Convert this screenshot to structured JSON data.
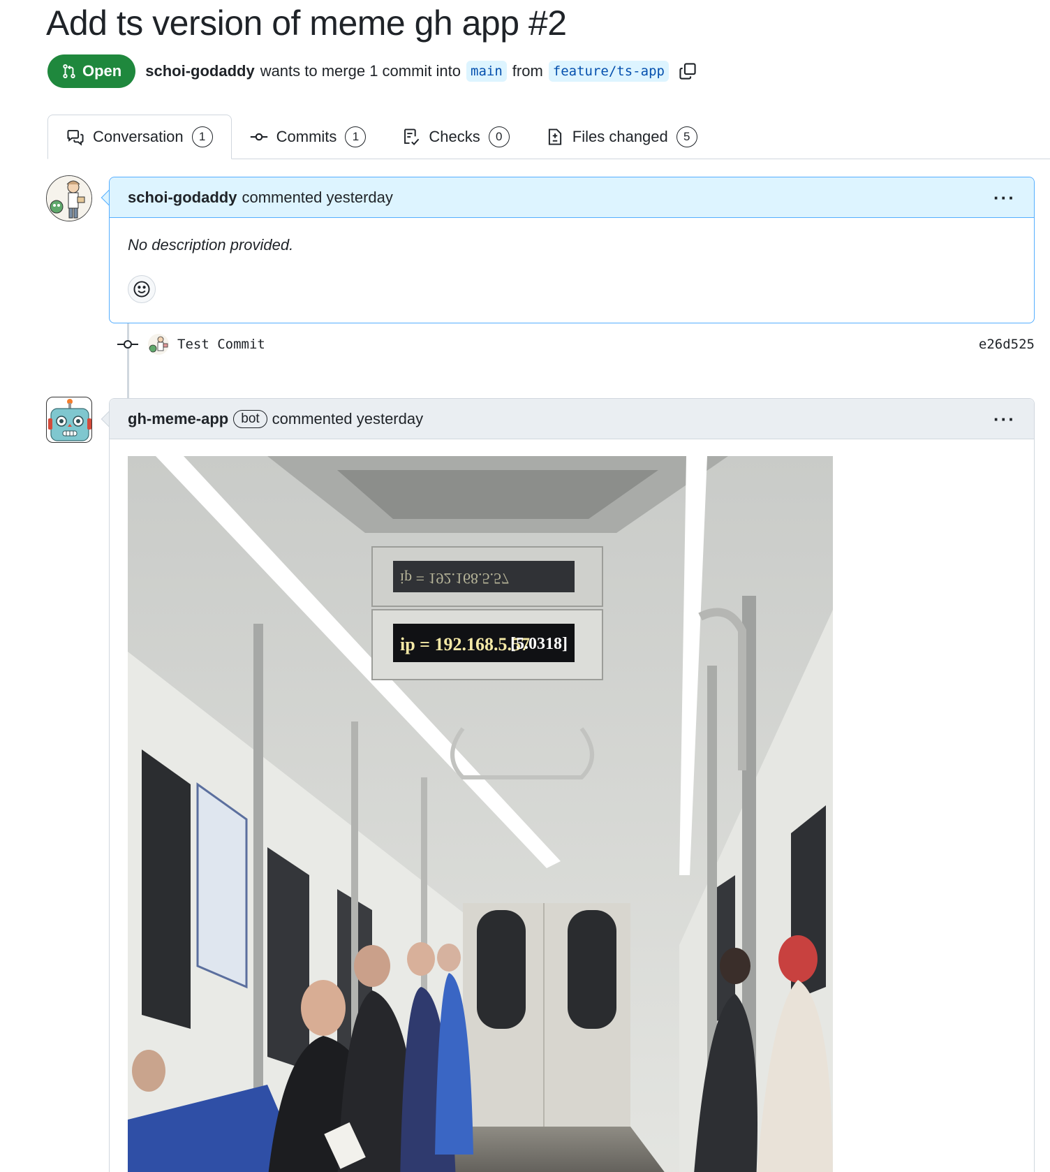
{
  "pr": {
    "title": "Add ts version of meme gh app #2",
    "state": "Open",
    "author": "schoi-godaddy",
    "merge_text": "wants to merge 1 commit into",
    "base_branch": "main",
    "from_text": "from",
    "head_branch": "feature/ts-app"
  },
  "tabs": [
    {
      "label": "Conversation",
      "count": "1",
      "icon": "comment-discussion-icon"
    },
    {
      "label": "Commits",
      "count": "1",
      "icon": "git-commit-icon"
    },
    {
      "label": "Checks",
      "count": "0",
      "icon": "checklist-icon"
    },
    {
      "label": "Files changed",
      "count": "5",
      "icon": "file-diff-icon"
    }
  ],
  "comments": [
    {
      "author": "schoi-godaddy",
      "action": "commented yesterday",
      "body": "No description provided.",
      "icon": "smiley-icon"
    },
    {
      "author": "gh-meme-app",
      "badge": "bot",
      "action": "commented yesterday"
    }
  ],
  "commit": {
    "message": "Test Commit",
    "sha": "e26d525"
  },
  "meme_sign": {
    "line1": "ip = 192.168.5.57",
    "line1_suffix": "[5.0318]"
  },
  "colors": {
    "open_green": "#1f883d",
    "branch_bg": "#ddf4ff",
    "branch_fg": "#0550ae",
    "comment_highlight": "#ddf4ff",
    "comment_border_blue": "#54aeff"
  }
}
